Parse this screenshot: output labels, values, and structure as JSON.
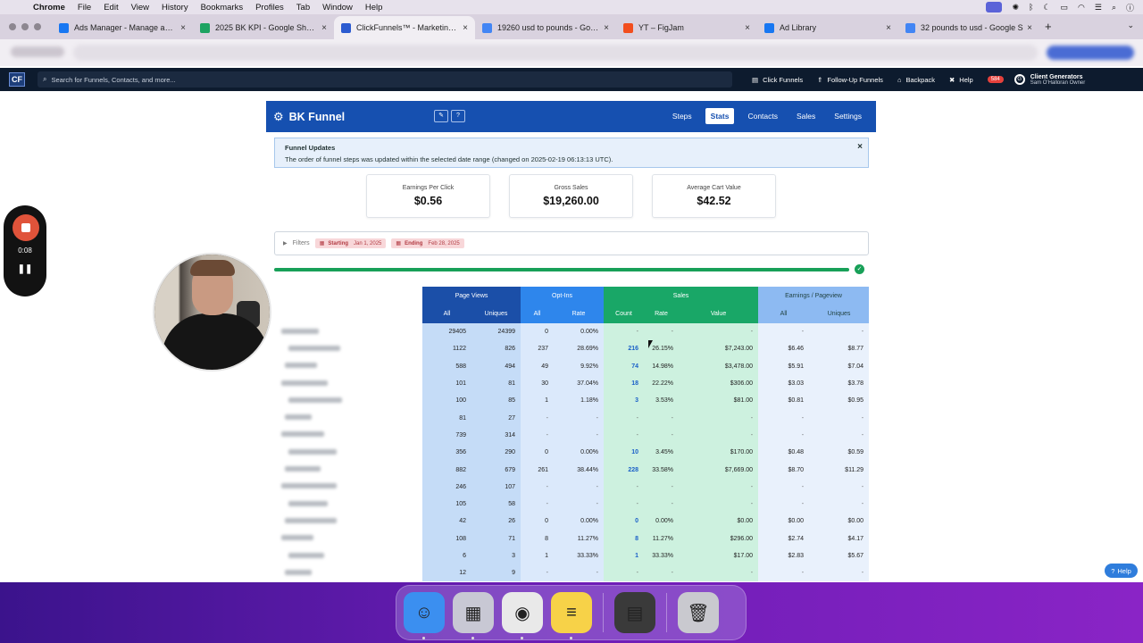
{
  "menubar": {
    "app": "Chrome",
    "items": [
      "File",
      "Edit",
      "View",
      "History",
      "Bookmarks",
      "Profiles",
      "Tab",
      "Window",
      "Help"
    ]
  },
  "tabs": [
    {
      "title": "Ads Manager - Manage ads -",
      "icon": "meta-icon",
      "color": "#1877f2"
    },
    {
      "title": "2025 BK KPI - Google Sheets",
      "icon": "sheets-icon",
      "color": "#1ea362"
    },
    {
      "title": "ClickFunnels™ - Marketing Fu",
      "icon": "clickfunnels-icon",
      "color": "#2c5bd0",
      "active": true
    },
    {
      "title": "19260 usd to pounds - Googl",
      "icon": "google-icon",
      "color": "#4285f4"
    },
    {
      "title": "YT – FigJam",
      "icon": "figma-icon",
      "color": "#f24e1e"
    },
    {
      "title": "Ad Library",
      "icon": "meta-icon",
      "color": "#1877f2"
    },
    {
      "title": "32 pounds to usd - Google S",
      "icon": "google-icon",
      "color": "#4285f4"
    }
  ],
  "cfbar": {
    "logo": "CF",
    "search_placeholder": "Search for Funnels, Contacts, and more...",
    "links": [
      "Click Funnels",
      "Follow-Up Funnels",
      "Backpack",
      "Help"
    ],
    "badge": "584",
    "account_name": "Client Generators",
    "account_sub": "Sam O'Halloran Owner"
  },
  "funnel": {
    "name": "BK Funnel",
    "nav": [
      "Steps",
      "Stats",
      "Contacts",
      "Sales",
      "Settings"
    ],
    "active_nav": "Stats"
  },
  "updates": {
    "title": "Funnel Updates",
    "message": "The order of funnel steps was updated within the selected date range (changed on 2025-02-19 06:13:13 UTC).",
    "close": "×"
  },
  "stats": [
    {
      "label": "Earnings Per Click",
      "value": "$0.56"
    },
    {
      "label": "Gross Sales",
      "value": "$19,260.00"
    },
    {
      "label": "Average Cart Value",
      "value": "$42.52"
    }
  ],
  "filters": {
    "label": "Filters",
    "start_label": "Starting",
    "start_value": "Jan 1, 2025",
    "end_label": "Ending",
    "end_value": "Feb 28, 2025"
  },
  "progress": 1.0,
  "table": {
    "groups": [
      "Page Views",
      "Opt-Ins",
      "Sales",
      "Earnings / Pageview"
    ],
    "subheaders": [
      "All",
      "Uniques",
      "All",
      "Rate",
      "Count",
      "Rate",
      "Value",
      "All",
      "Uniques"
    ],
    "rows": [
      [
        "29405",
        "24399",
        "0",
        "0.00%",
        "-",
        "-",
        "-",
        "-",
        "-"
      ],
      [
        "1122",
        "826",
        "237",
        "28.69%",
        "216",
        "26.15%",
        "$7,243.00",
        "$6.46",
        "$8.77"
      ],
      [
        "588",
        "494",
        "49",
        "9.92%",
        "74",
        "14.98%",
        "$3,478.00",
        "$5.91",
        "$7.04"
      ],
      [
        "101",
        "81",
        "30",
        "37.04%",
        "18",
        "22.22%",
        "$306.00",
        "$3.03",
        "$3.78"
      ],
      [
        "100",
        "85",
        "1",
        "1.18%",
        "3",
        "3.53%",
        "$81.00",
        "$0.81",
        "$0.95"
      ],
      [
        "81",
        "27",
        "-",
        "-",
        "-",
        "-",
        "-",
        "-",
        "-"
      ],
      [
        "739",
        "314",
        "-",
        "-",
        "-",
        "-",
        "-",
        "-",
        "-"
      ],
      [
        "356",
        "290",
        "0",
        "0.00%",
        "10",
        "3.45%",
        "$170.00",
        "$0.48",
        "$0.59"
      ],
      [
        "882",
        "679",
        "261",
        "38.44%",
        "228",
        "33.58%",
        "$7,669.00",
        "$8.70",
        "$11.29"
      ],
      [
        "246",
        "107",
        "-",
        "-",
        "-",
        "-",
        "-",
        "-",
        "-"
      ],
      [
        "105",
        "58",
        "-",
        "-",
        "-",
        "-",
        "-",
        "-",
        "-"
      ],
      [
        "42",
        "26",
        "0",
        "0.00%",
        "0",
        "0.00%",
        "$0.00",
        "$0.00",
        "$0.00"
      ],
      [
        "108",
        "71",
        "8",
        "11.27%",
        "8",
        "11.27%",
        "$296.00",
        "$2.74",
        "$4.17"
      ],
      [
        "6",
        "3",
        "1",
        "33.33%",
        "1",
        "33.33%",
        "$17.00",
        "$2.83",
        "$5.67"
      ],
      [
        "12",
        "9",
        "-",
        "-",
        "-",
        "-",
        "-",
        "-",
        "-"
      ]
    ]
  },
  "recorder": {
    "time": "0:08",
    "pause": "❚❚"
  },
  "help_button": "Help",
  "dock": [
    {
      "name": "finder-icon",
      "glyph": "☺",
      "color": "#3b8ff0"
    },
    {
      "name": "launchpad-icon",
      "glyph": "▦",
      "color": "#c8c8d4"
    },
    {
      "name": "chrome-icon",
      "glyph": "◉",
      "color": "#e9e9e9"
    },
    {
      "name": "notes-icon",
      "glyph": "≡",
      "color": "#f7d248"
    },
    {
      "name": "calculator-icon",
      "glyph": "▤",
      "color": "#3a3a3a"
    },
    {
      "name": "trash-icon",
      "glyph": "🗑",
      "color": "#c9c9cf"
    }
  ]
}
